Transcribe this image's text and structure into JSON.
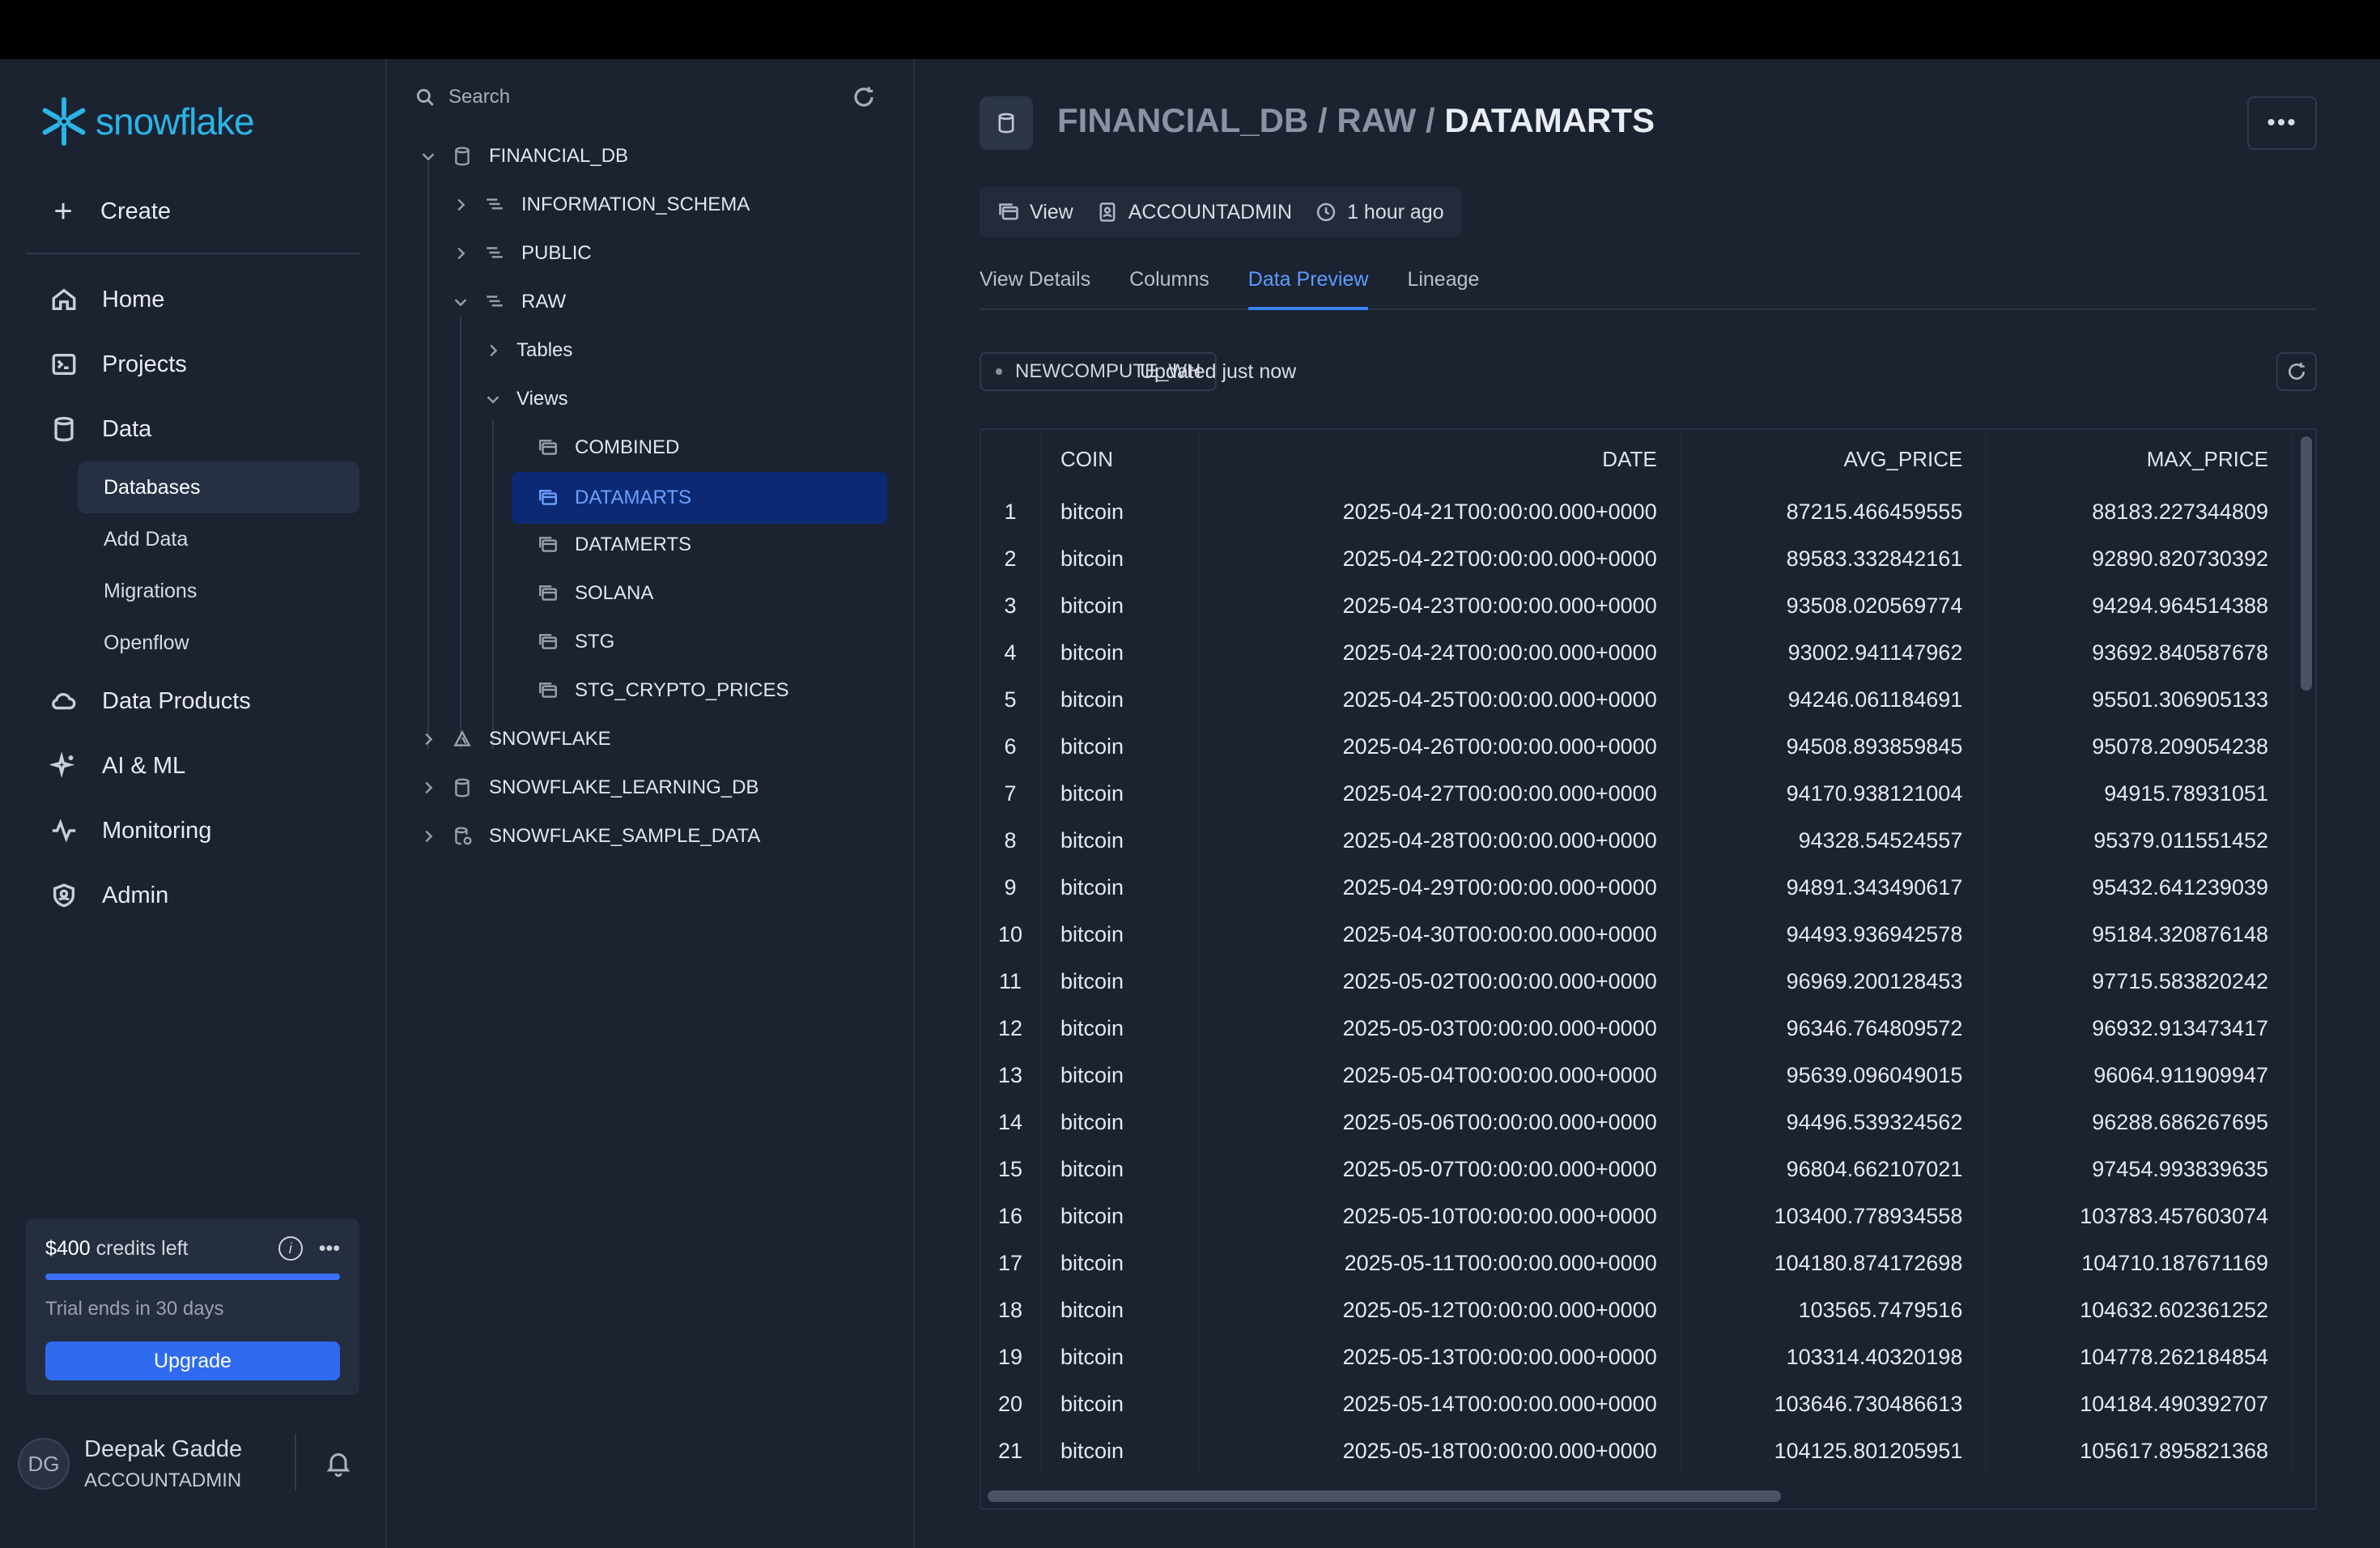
{
  "brand": {
    "name": "snowflake",
    "color": "#29b5e8"
  },
  "nav": {
    "create_label": "Create",
    "items": [
      {
        "label": "Home",
        "icon": "home-icon"
      },
      {
        "label": "Projects",
        "icon": "projects-icon"
      },
      {
        "label": "Data",
        "icon": "data-icon"
      }
    ],
    "data_sub": [
      {
        "label": "Databases",
        "active": true
      },
      {
        "label": "Add Data"
      },
      {
        "label": "Migrations"
      },
      {
        "label": "Openflow"
      }
    ],
    "items2": [
      {
        "label": "Data Products",
        "icon": "cloud-icon"
      },
      {
        "label": "AI & ML",
        "icon": "sparkle-icon"
      },
      {
        "label": "Monitoring",
        "icon": "pulse-icon"
      },
      {
        "label": "Admin",
        "icon": "shield-icon"
      }
    ]
  },
  "credits": {
    "amount": "$400",
    "suffix": "credits left",
    "trial": "Trial ends in 30 days",
    "upgrade_label": "Upgrade"
  },
  "user": {
    "initials": "DG",
    "name": "Deepak Gadde",
    "role": "ACCOUNTADMIN"
  },
  "tree": {
    "search_placeholder": "Search",
    "nodes": {
      "financial_db": "FINANCIAL_DB",
      "information_schema": "INFORMATION_SCHEMA",
      "public": "PUBLIC",
      "raw": "RAW",
      "tables": "Tables",
      "views": "Views",
      "combined": "COMBINED",
      "datamarts": "DATAMARTS",
      "datamerts": "DATAMERTS",
      "solana": "SOLANA",
      "stg": "STG",
      "stg_crypto_prices": "STG_CRYPTO_PRICES",
      "snowflake": "SNOWFLAKE",
      "snowflake_learning_db": "SNOWFLAKE_LEARNING_DB",
      "snowflake_sample_data": "SNOWFLAKE_SAMPLE_DATA"
    }
  },
  "header": {
    "path_prefix": "FINANCIAL_DB / RAW / ",
    "current": "DATAMARTS",
    "meta_type": "View",
    "meta_owner": "ACCOUNTADMIN",
    "meta_time": "1 hour ago"
  },
  "tabs": [
    "View Details",
    "Columns",
    "Data Preview",
    "Lineage"
  ],
  "warehouse": {
    "name": "NEWCOMPUTE_WH",
    "status": "Updated just now"
  },
  "table": {
    "columns": [
      "COIN",
      "DATE",
      "AVG_PRICE",
      "MAX_PRICE"
    ],
    "rows": [
      [
        "1",
        "bitcoin",
        "2025-04-21T00:00:00.000+0000",
        "87215.466459555",
        "88183.227344809"
      ],
      [
        "2",
        "bitcoin",
        "2025-04-22T00:00:00.000+0000",
        "89583.332842161",
        "92890.820730392"
      ],
      [
        "3",
        "bitcoin",
        "2025-04-23T00:00:00.000+0000",
        "93508.020569774",
        "94294.964514388"
      ],
      [
        "4",
        "bitcoin",
        "2025-04-24T00:00:00.000+0000",
        "93002.941147962",
        "93692.840587678"
      ],
      [
        "5",
        "bitcoin",
        "2025-04-25T00:00:00.000+0000",
        "94246.061184691",
        "95501.306905133"
      ],
      [
        "6",
        "bitcoin",
        "2025-04-26T00:00:00.000+0000",
        "94508.893859845",
        "95078.209054238"
      ],
      [
        "7",
        "bitcoin",
        "2025-04-27T00:00:00.000+0000",
        "94170.938121004",
        "94915.78931051"
      ],
      [
        "8",
        "bitcoin",
        "2025-04-28T00:00:00.000+0000",
        "94328.54524557",
        "95379.011551452"
      ],
      [
        "9",
        "bitcoin",
        "2025-04-29T00:00:00.000+0000",
        "94891.343490617",
        "95432.641239039"
      ],
      [
        "10",
        "bitcoin",
        "2025-04-30T00:00:00.000+0000",
        "94493.936942578",
        "95184.320876148"
      ],
      [
        "11",
        "bitcoin",
        "2025-05-02T00:00:00.000+0000",
        "96969.200128453",
        "97715.583820242"
      ],
      [
        "12",
        "bitcoin",
        "2025-05-03T00:00:00.000+0000",
        "96346.764809572",
        "96932.913473417"
      ],
      [
        "13",
        "bitcoin",
        "2025-05-04T00:00:00.000+0000",
        "95639.096049015",
        "96064.911909947"
      ],
      [
        "14",
        "bitcoin",
        "2025-05-06T00:00:00.000+0000",
        "94496.539324562",
        "96288.686267695"
      ],
      [
        "15",
        "bitcoin",
        "2025-05-07T00:00:00.000+0000",
        "96804.662107021",
        "97454.993839635"
      ],
      [
        "16",
        "bitcoin",
        "2025-05-10T00:00:00.000+0000",
        "103400.778934558",
        "103783.457603074"
      ],
      [
        "17",
        "bitcoin",
        "2025-05-11T00:00:00.000+0000",
        "104180.874172698",
        "104710.187671169"
      ],
      [
        "18",
        "bitcoin",
        "2025-05-12T00:00:00.000+0000",
        "103565.7479516",
        "104632.602361252"
      ],
      [
        "19",
        "bitcoin",
        "2025-05-13T00:00:00.000+0000",
        "103314.40320198",
        "104778.262184854"
      ],
      [
        "20",
        "bitcoin",
        "2025-05-14T00:00:00.000+0000",
        "103646.730486613",
        "104184.490392707"
      ],
      [
        "21",
        "bitcoin",
        "2025-05-18T00:00:00.000+0000",
        "104125.801205951",
        "105617.895821368"
      ]
    ]
  }
}
